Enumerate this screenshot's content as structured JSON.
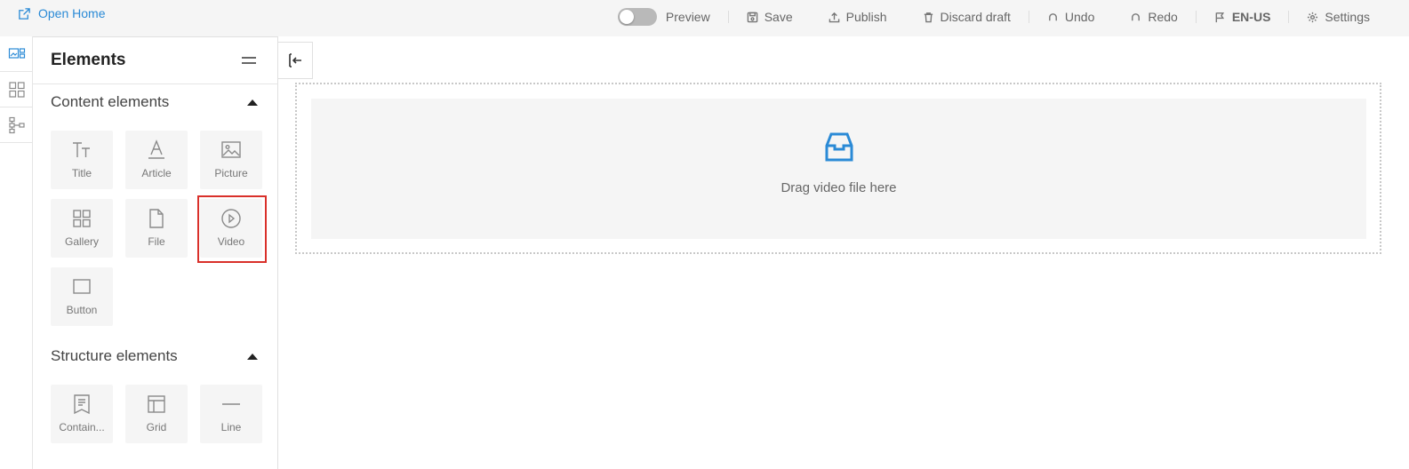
{
  "topbar": {
    "open_home": "Open Home",
    "preview": "Preview",
    "save": "Save",
    "publish": "Publish",
    "discard": "Discard draft",
    "undo": "Undo",
    "redo": "Redo",
    "language": "EN-US",
    "settings": "Settings",
    "preview_toggle_on": false
  },
  "rail": {
    "items": [
      "elements-icon",
      "pages-icon",
      "structure-tree-icon"
    ]
  },
  "panel": {
    "title": "Elements",
    "content_section": {
      "title": "Content elements",
      "items": [
        {
          "label": "Title",
          "icon": "title-icon"
        },
        {
          "label": "Article",
          "icon": "article-icon"
        },
        {
          "label": "Picture",
          "icon": "picture-icon"
        },
        {
          "label": "Gallery",
          "icon": "gallery-icon"
        },
        {
          "label": "File",
          "icon": "file-icon"
        },
        {
          "label": "Video",
          "icon": "video-icon"
        },
        {
          "label": "Button",
          "icon": "button-icon"
        }
      ]
    },
    "structure_section": {
      "title": "Structure elements",
      "items": [
        {
          "label": "Contain...",
          "icon": "container-icon"
        },
        {
          "label": "Grid",
          "icon": "grid-icon"
        },
        {
          "label": "Line",
          "icon": "line-icon"
        }
      ]
    }
  },
  "canvas": {
    "drop_text": "Drag video file here"
  },
  "colors": {
    "accent": "#2a8ad6",
    "highlight": "#d9302a"
  }
}
